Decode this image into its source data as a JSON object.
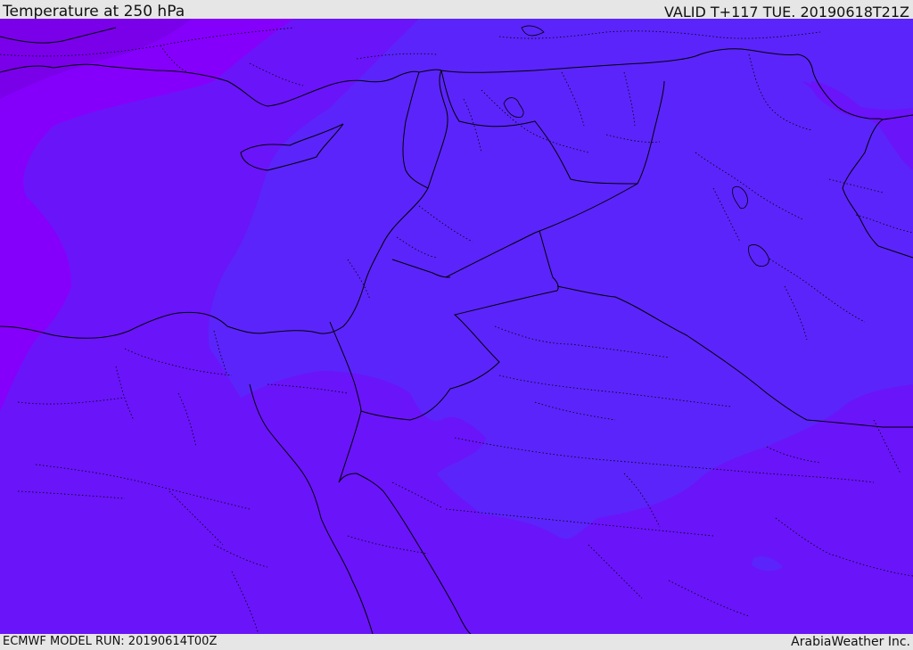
{
  "header": {
    "title": "Temperature at 250 hPa",
    "valid_time": "VALID T+117 TUE. 20190618T21Z"
  },
  "footer": {
    "model_run": "ECMWF MODEL RUN: 20190614T00Z",
    "credit": "ArabiaWeather Inc."
  },
  "colors": {
    "background_bars": "#e6e6e6",
    "field_base": "#6a14fa",
    "field_warm_band": "#5b24fb",
    "field_cold_west": "#8500fb",
    "field_cold_nw": "#7a00ea",
    "border_line": "#000000"
  }
}
